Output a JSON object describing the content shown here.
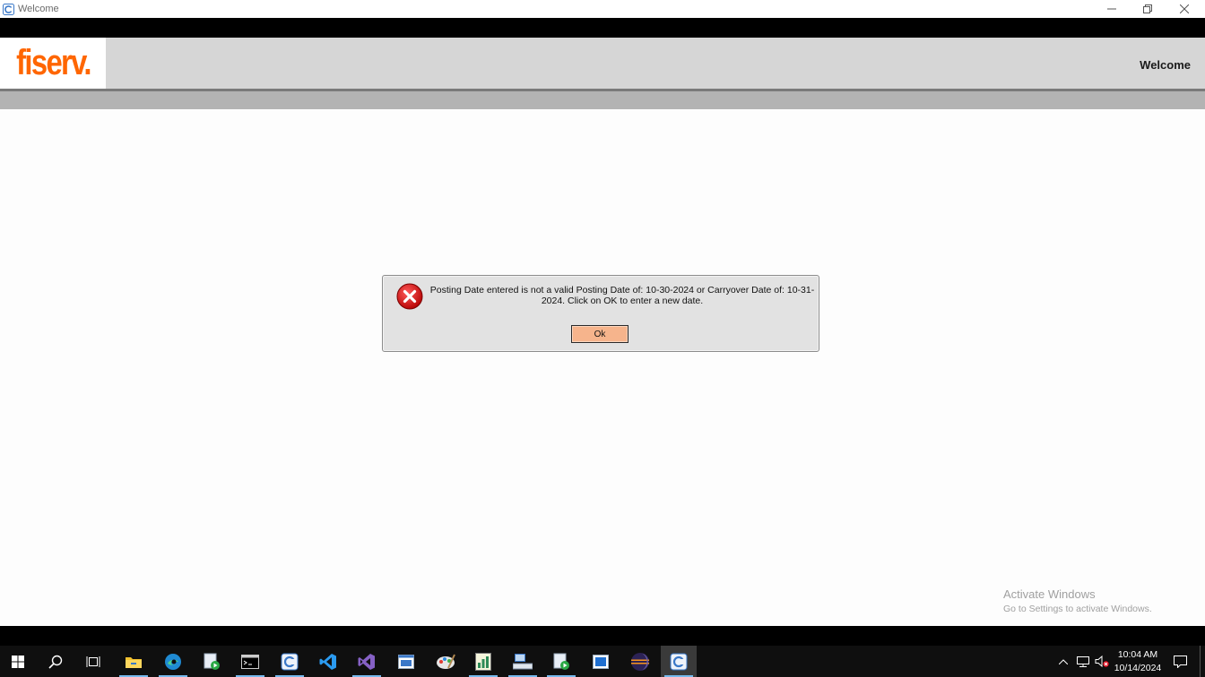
{
  "window": {
    "title": "Welcome",
    "controls": [
      "minimize-icon",
      "restore-icon",
      "close-icon"
    ]
  },
  "header": {
    "logo_text": "fiserv.",
    "logo_color": "#ff6600",
    "page_label": "Welcome"
  },
  "dialog": {
    "icon": "error-icon",
    "message": "Posting Date entered is not a valid Posting Date of: 10-30-2024 or Carryover Date of: 10-31-2024. Click on OK to enter a new date.",
    "ok_label": "Ok"
  },
  "watermark": {
    "line1": "Activate Windows",
    "line2": "Go to Settings to activate Windows."
  },
  "taskbar": {
    "items": [
      {
        "name": "start-icon"
      },
      {
        "name": "search-icon"
      },
      {
        "name": "task-view-icon"
      },
      {
        "name": "file-explorer-icon"
      },
      {
        "name": "edge-icon"
      },
      {
        "name": "app-launcher-icon"
      },
      {
        "name": "terminal-icon"
      },
      {
        "name": "app-icon"
      },
      {
        "name": "vscode-icon"
      },
      {
        "name": "visual-studio-icon"
      },
      {
        "name": "window-app-icon"
      },
      {
        "name": "paint-app-icon"
      },
      {
        "name": "chart-app-icon"
      },
      {
        "name": "network-app-icon"
      },
      {
        "name": "launcher-app-icon"
      },
      {
        "name": "blue-window-icon"
      },
      {
        "name": "eclipse-icon"
      },
      {
        "name": "app-icon-active"
      }
    ],
    "clock": {
      "time": "10:04 AM",
      "date": "10/14/2024"
    }
  }
}
